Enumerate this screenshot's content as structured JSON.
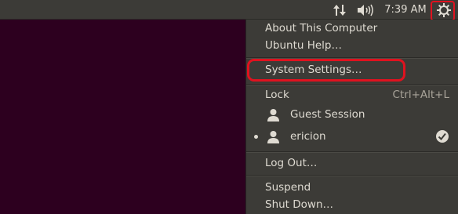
{
  "topbar": {
    "clock": "7:39 AM",
    "network_icon": "network-arrows-icon",
    "volume_icon": "volume-icon",
    "settings_icon": "gear-icon"
  },
  "menu": {
    "about": "About This Computer",
    "help": "Ubuntu Help…",
    "system_settings": "System Settings…",
    "lock": "Lock",
    "lock_shortcut": "Ctrl+Alt+L",
    "guest": "Guest Session",
    "user": "ericion",
    "logout": "Log Out…",
    "suspend": "Suspend",
    "shutdown": "Shut Down…"
  },
  "colors": {
    "desktop": "#2c001e",
    "panel": "#3c3b37",
    "text": "#dfdbd2",
    "highlight": "#e0121f"
  }
}
